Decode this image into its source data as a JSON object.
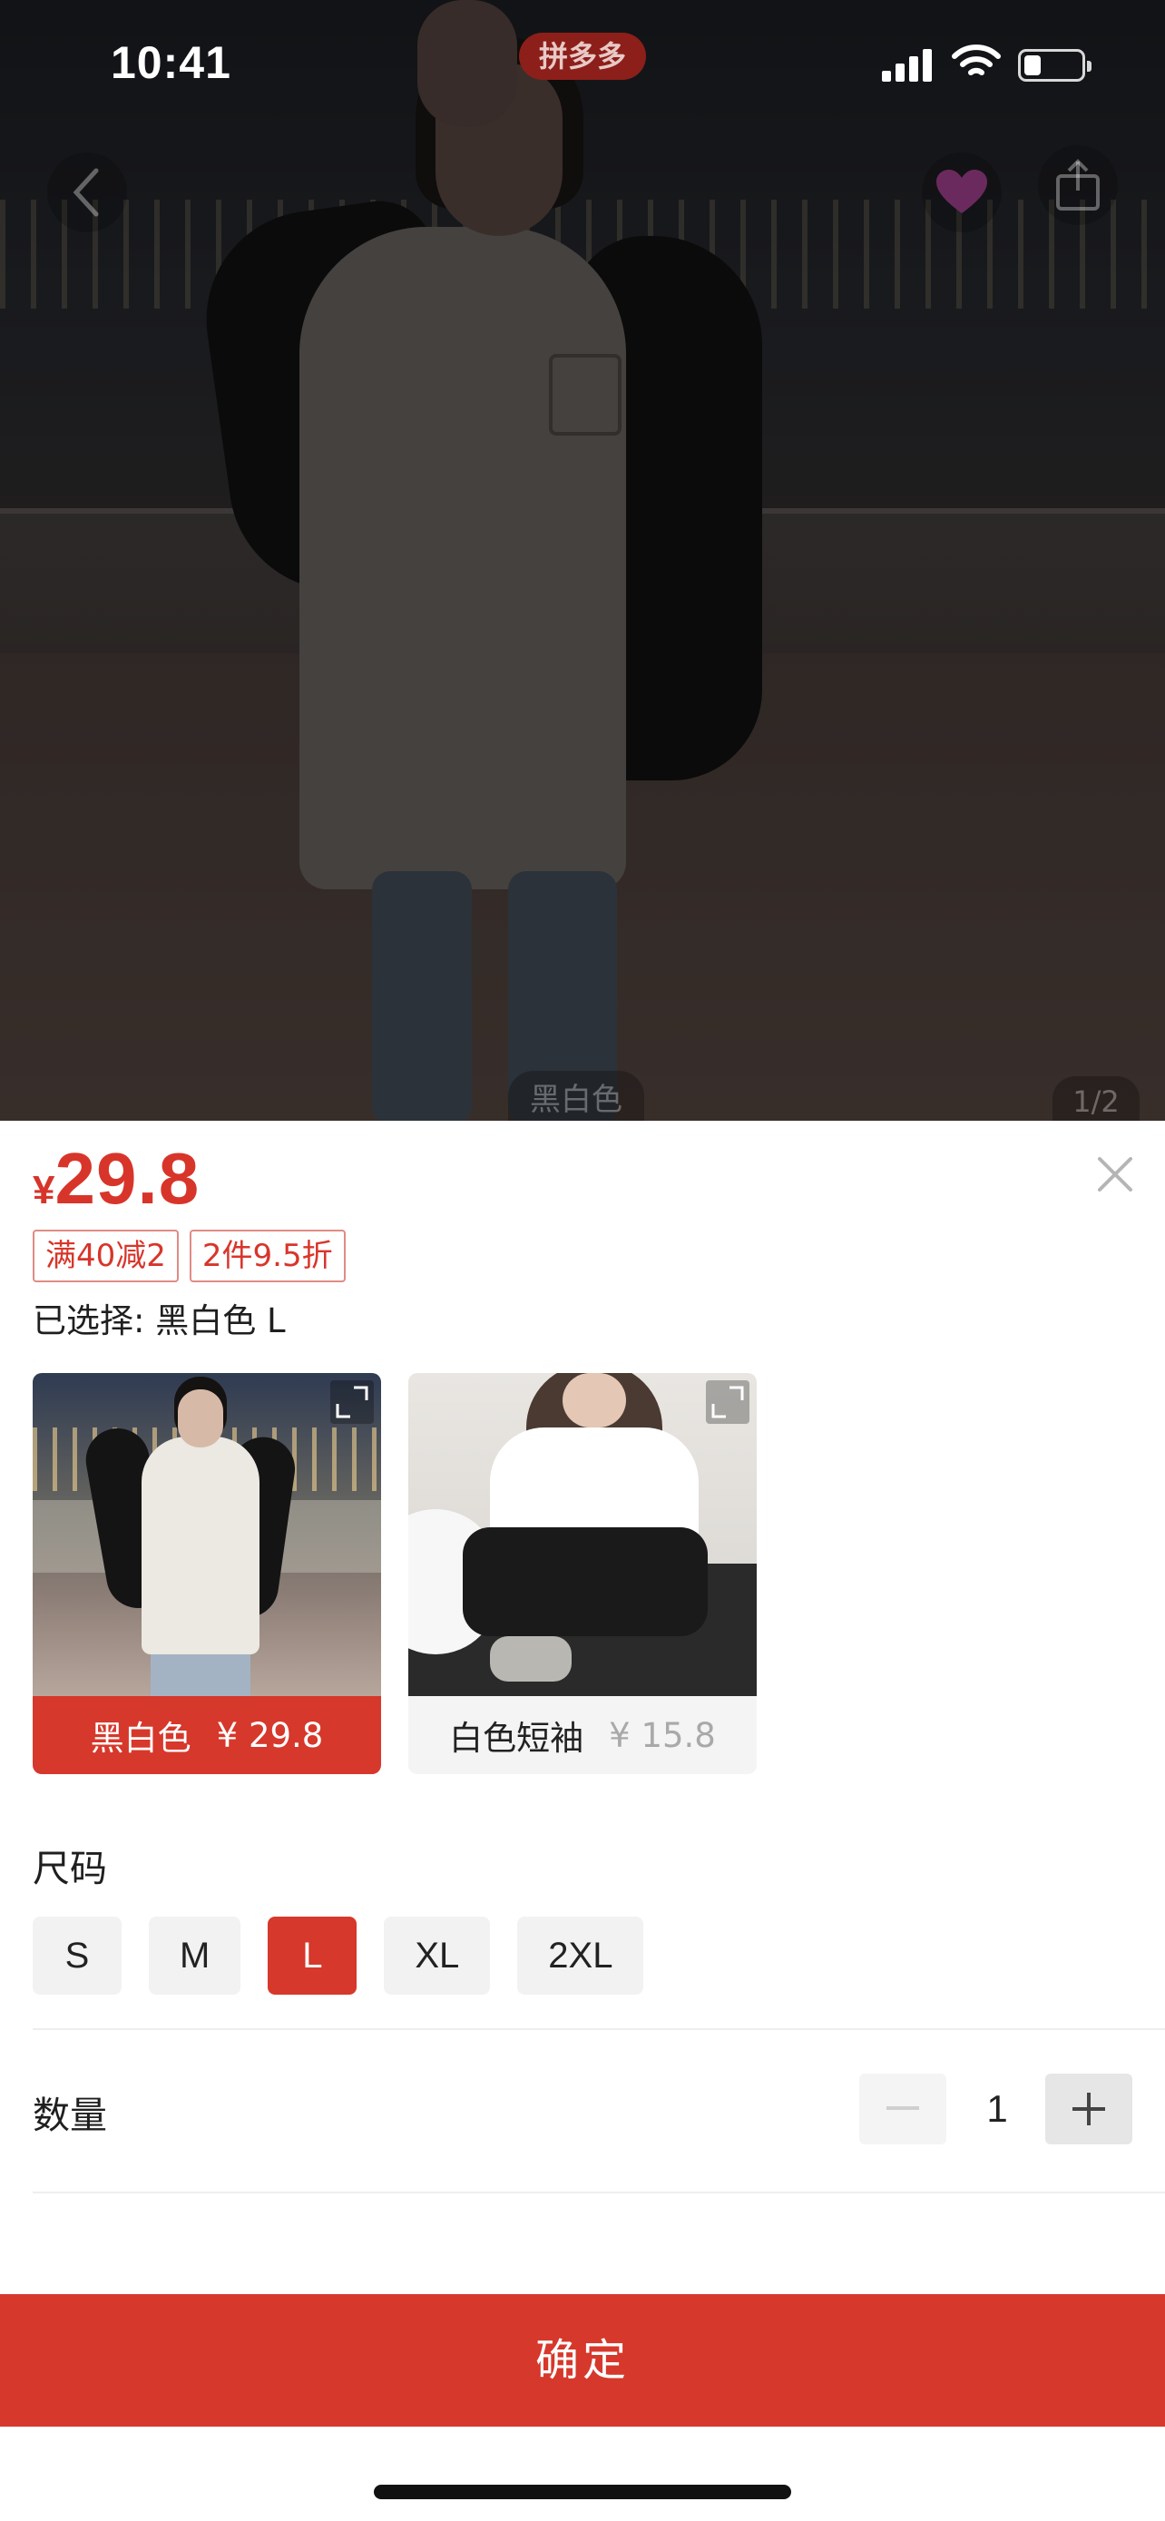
{
  "status_bar": {
    "time": "10:41",
    "app_badge": "拼多多"
  },
  "photo": {
    "caption": "黑白色",
    "counter": "1/2"
  },
  "sheet": {
    "currency": "¥",
    "price": "29.8",
    "promo_tags": [
      "满40减2",
      "2件9.5折"
    ],
    "selected_text": "已选择: 黑白色 L",
    "variants": [
      {
        "name": "黑白色",
        "price": "¥ 29.8",
        "selected": true
      },
      {
        "name": "白色短袖",
        "price": "¥ 15.8",
        "selected": false
      }
    ],
    "size_title": "尺码",
    "sizes": [
      "S",
      "M",
      "L",
      "XL",
      "2XL"
    ],
    "selected_size": "L",
    "quantity_label": "数量",
    "quantity": "1",
    "confirm_label": "确定"
  },
  "colors": {
    "accent": "#d6382b",
    "price": "#d8352a"
  },
  "icons": {
    "back": "chevron-left-icon",
    "favorite": "heart-icon",
    "share": "share-icon",
    "close": "close-icon",
    "expand": "expand-icon",
    "minus": "minus-icon",
    "plus": "plus-icon"
  }
}
